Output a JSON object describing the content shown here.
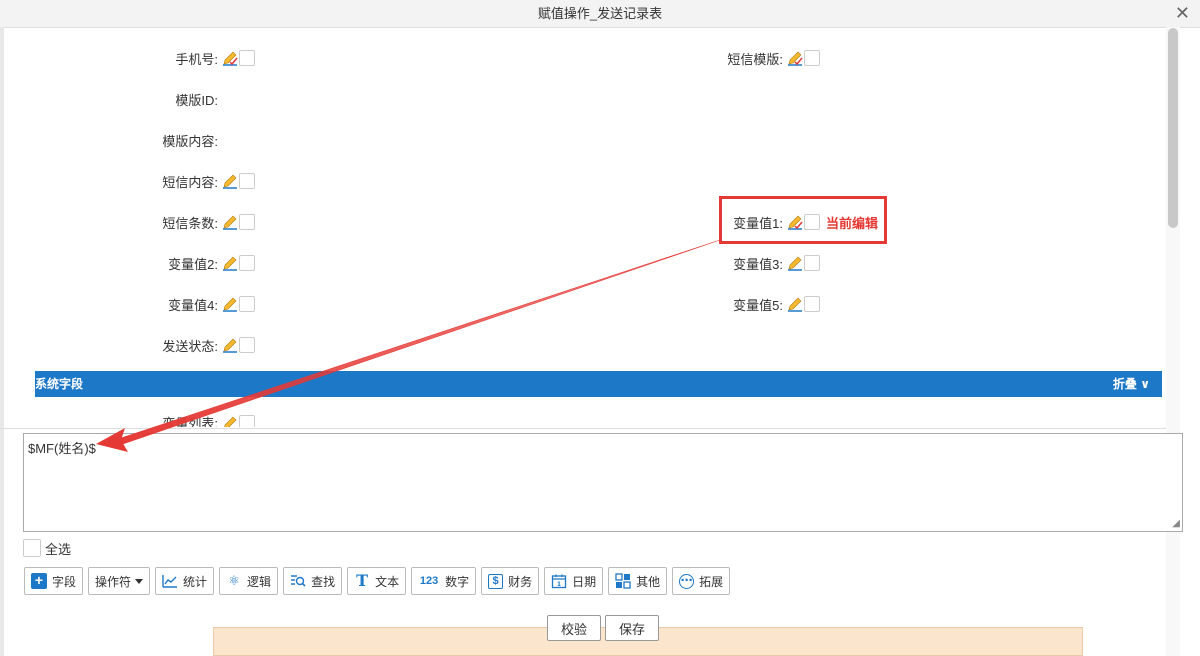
{
  "window": {
    "title": "赋值操作_发送记录表",
    "close_glyph": "✕"
  },
  "fields_left": [
    {
      "label": "手机号:",
      "editable": true
    },
    {
      "label": "模版ID:",
      "editable": false
    },
    {
      "label": "模版内容:",
      "editable": false
    },
    {
      "label": "短信内容:",
      "editable": true
    },
    {
      "label": "短信条数:",
      "editable": true
    },
    {
      "label": "变量值2:",
      "editable": true
    },
    {
      "label": "变量值4:",
      "editable": true
    },
    {
      "label": "发送状态:",
      "editable": true
    }
  ],
  "fields_right": [
    {
      "label": "短信模版:"
    },
    {
      "label": "变量值1:"
    },
    {
      "label": "变量值3:"
    },
    {
      "label": "变量值5:"
    }
  ],
  "current_edit_tag": "当前编辑",
  "system_section": {
    "title": "系统字段",
    "collapse_label": "折叠",
    "collapse_glyph": "∨"
  },
  "clipped_field": {
    "label": "变量列表:"
  },
  "editor": {
    "value": "$MF(姓名)$"
  },
  "select_all_label": "全选",
  "toolbar": [
    {
      "name": "field-button",
      "icon": "plus-icon",
      "label": "字段"
    },
    {
      "name": "operator-button",
      "icon": "",
      "label": "操作符"
    },
    {
      "name": "statistics-button",
      "icon": "chart-icon",
      "label": "统计"
    },
    {
      "name": "logic-button",
      "icon": "atom-icon",
      "label": "逻辑"
    },
    {
      "name": "search-button",
      "icon": "search-list-icon",
      "label": "查找"
    },
    {
      "name": "text-button",
      "icon": "text-icon",
      "label": "文本"
    },
    {
      "name": "number-button",
      "icon": "number-icon",
      "label": "数字"
    },
    {
      "name": "finance-button",
      "icon": "dollar-icon",
      "label": "财务"
    },
    {
      "name": "date-button",
      "icon": "calendar-icon",
      "label": "日期"
    },
    {
      "name": "other-button",
      "icon": "grid-icon",
      "label": "其他"
    },
    {
      "name": "extend-button",
      "icon": "more-icon",
      "label": "拓展"
    }
  ],
  "toolbar_glyphs": {
    "plus": "+",
    "chart": "⌇",
    "atom": "⚛",
    "search": "⌕",
    "text": "T",
    "number": "123",
    "dollar": "$",
    "calendar": "▦",
    "grid": "▚",
    "more": "⋯"
  },
  "actions": {
    "validate": "校验",
    "save": "保存"
  },
  "colors": {
    "accent": "#1e78c8",
    "highlight": "#e53935"
  }
}
